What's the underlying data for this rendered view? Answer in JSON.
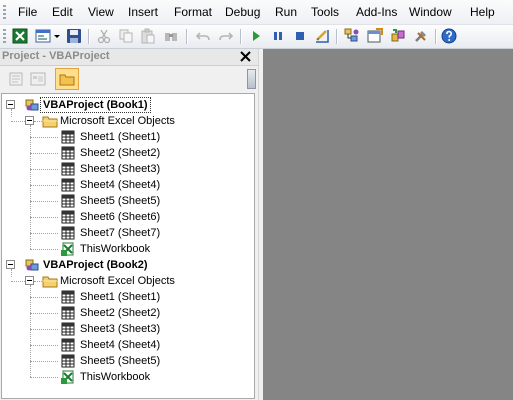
{
  "menubar": {
    "items": [
      "File",
      "Edit",
      "View",
      "Insert",
      "Format",
      "Debug",
      "Run",
      "Tools",
      "Add-Ins",
      "Window",
      "Help"
    ]
  },
  "toolbar": {
    "icons": [
      "excel-icon",
      "insert-userform-icon",
      "dropdown-arrow-icon",
      "save-icon",
      "cut-icon",
      "copy-icon",
      "paste-icon",
      "find-icon",
      "undo-icon",
      "redo-icon",
      "run-icon",
      "break-icon",
      "reset-icon",
      "design-mode-icon",
      "project-explorer-icon",
      "properties-window-icon",
      "object-browser-icon",
      "toolbox-icon",
      "help-icon"
    ]
  },
  "project_pane": {
    "title": "Project - VBAProject",
    "buttons": [
      "view-code-icon",
      "view-object-icon",
      "toggle-folders-icon"
    ],
    "projects": [
      {
        "name": "VBAProject (Book1)",
        "folder": "Microsoft Excel Objects",
        "items": [
          "Sheet1 (Sheet1)",
          "Sheet2 (Sheet2)",
          "Sheet3 (Sheet3)",
          "Sheet4 (Sheet4)",
          "Sheet5 (Sheet5)",
          "Sheet6 (Sheet6)",
          "Sheet7 (Sheet7)",
          "ThisWorkbook"
        ]
      },
      {
        "name": "VBAProject (Book2)",
        "folder": "Microsoft Excel Objects",
        "items": [
          "Sheet1 (Sheet1)",
          "Sheet2 (Sheet2)",
          "Sheet3 (Sheet3)",
          "Sheet4 (Sheet4)",
          "Sheet5 (Sheet5)",
          "ThisWorkbook"
        ]
      }
    ]
  },
  "colors": {
    "workspace": "#858585",
    "selected_button": "#ffdf8e"
  }
}
